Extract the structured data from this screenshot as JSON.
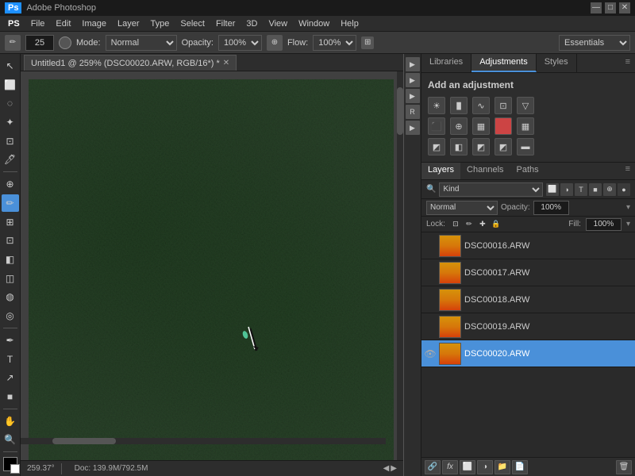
{
  "titlebar": {
    "title": "Adobe Photoshop",
    "ps_icon": "Ps",
    "controls": [
      "—",
      "□",
      "✕"
    ]
  },
  "menubar": {
    "items": [
      "PS",
      "File",
      "Edit",
      "Image",
      "Layer",
      "Type",
      "Select",
      "Filter",
      "3D",
      "View",
      "Window",
      "Help"
    ]
  },
  "optionsbar": {
    "brush_size": "25",
    "mode_label": "Mode:",
    "mode_value": "Normal",
    "opacity_label": "Opacity:",
    "opacity_value": "100%",
    "flow_label": "Flow:",
    "flow_value": "100%",
    "workspace_label": "Essentials"
  },
  "canvas": {
    "tab_title": "Untitled1 @ 259% (DSC00020.ARW, RGB/16*) *",
    "zoom": "259.37°",
    "doc_info": "Doc: 139.9M/792.5M"
  },
  "adjustments_panel": {
    "tabs": [
      "Libraries",
      "Adjustments",
      "Styles"
    ],
    "active_tab": "Adjustments",
    "section_title": "Add an adjustment",
    "icons_row1": [
      "☀",
      "≋",
      "◪",
      "◩",
      "▽"
    ],
    "icons_row2": [
      "⬛",
      "⊕",
      "▦",
      "🔴",
      "▦"
    ],
    "icons_row3": [
      "◩",
      "◧",
      "◩",
      "◩",
      "▬"
    ]
  },
  "layers_panel": {
    "tabs": [
      "Layers",
      "Channels",
      "Paths"
    ],
    "active_tab": "Layers",
    "filter_type": "Kind",
    "blend_mode": "Normal",
    "opacity_label": "Opacity:",
    "opacity_value": "100%",
    "lock_label": "Lock:",
    "fill_label": "Fill:",
    "fill_value": "100%",
    "layers": [
      {
        "id": "DSC00016",
        "name": "DSC00016.ARW",
        "visible": false,
        "active": false
      },
      {
        "id": "DSC00017",
        "name": "DSC00017.ARW",
        "visible": false,
        "active": false
      },
      {
        "id": "DSC00018",
        "name": "DSC00018.ARW",
        "visible": false,
        "active": false
      },
      {
        "id": "DSC00019",
        "name": "DSC00019.ARW",
        "visible": false,
        "active": false
      },
      {
        "id": "DSC00020",
        "name": "DSC00020.ARW",
        "visible": true,
        "active": true
      }
    ],
    "bottom_buttons": [
      "🔗",
      "fx",
      "🔲",
      "🗑",
      "📄",
      "📁"
    ]
  },
  "statusbar": {
    "zoom": "259.37°",
    "doc_info": "Doc: 139.9M/792.5M"
  },
  "toolbar": {
    "tools": [
      {
        "id": "move",
        "icon": "↖",
        "name": "Move Tool"
      },
      {
        "id": "select-rect",
        "icon": "⬜",
        "name": "Rectangular Marquee"
      },
      {
        "id": "lasso",
        "icon": "◌",
        "name": "Lasso Tool"
      },
      {
        "id": "magic-wand",
        "icon": "✦",
        "name": "Quick Selection"
      },
      {
        "id": "crop",
        "icon": "⊡",
        "name": "Crop Tool"
      },
      {
        "id": "eyedropper",
        "icon": "🖊",
        "name": "Eyedropper"
      },
      {
        "id": "patch",
        "icon": "⊕",
        "name": "Healing Brush"
      },
      {
        "id": "brush",
        "icon": "✏",
        "name": "Brush Tool",
        "active": true
      },
      {
        "id": "clone",
        "icon": "⊞",
        "name": "Clone Stamp"
      },
      {
        "id": "history",
        "icon": "⊡",
        "name": "History Brush"
      },
      {
        "id": "eraser",
        "icon": "◧",
        "name": "Eraser Tool"
      },
      {
        "id": "gradient",
        "icon": "◫",
        "name": "Gradient Tool"
      },
      {
        "id": "blur",
        "icon": "◍",
        "name": "Blur Tool"
      },
      {
        "id": "dodge",
        "icon": "◎",
        "name": "Dodge Tool"
      },
      {
        "id": "pen",
        "icon": "✒",
        "name": "Pen Tool"
      },
      {
        "id": "type",
        "icon": "T",
        "name": "Type Tool"
      },
      {
        "id": "path-sel",
        "icon": "↗",
        "name": "Path Selection"
      },
      {
        "id": "shape",
        "icon": "■",
        "name": "Shape Tool"
      },
      {
        "id": "hand",
        "icon": "✋",
        "name": "Hand Tool"
      },
      {
        "id": "zoom",
        "icon": "🔍",
        "name": "Zoom Tool"
      }
    ]
  }
}
